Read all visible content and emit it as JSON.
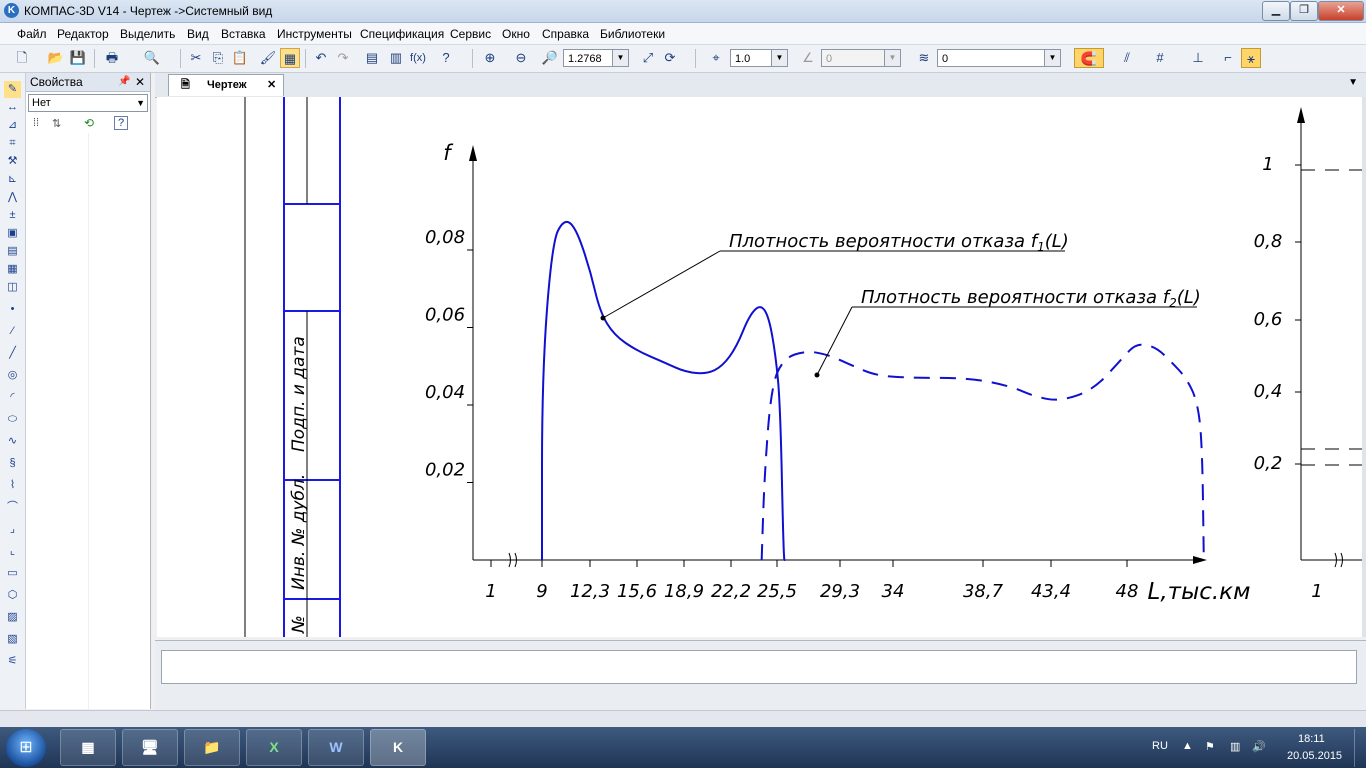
{
  "window": {
    "title": "КОМПАС-3D V14 - Чертеж ->Системный вид",
    "app_icon_letter": "K"
  },
  "menu": [
    "Файл",
    "Редактор",
    "Выделить",
    "Вид",
    "Вставка",
    "Инструменты",
    "Спецификация",
    "Сервис",
    "Окно",
    "Справка",
    "Библиотеки"
  ],
  "toolbar": {
    "zoom_value": "1.2768",
    "step_value": "1.0",
    "angle_value": "0",
    "layer_value": "0"
  },
  "properties": {
    "title": "Свойства",
    "select_value": "Нет"
  },
  "document_tab": {
    "label": "Чертеж"
  },
  "stamp": {
    "label_sign_date": "Подп. и дата",
    "label_inv_dubl": "Инв. № дубл.",
    "label_inv": "№"
  },
  "chart_data": {
    "type": "line",
    "ylabel": "f",
    "xlabel": "L,тыс.км",
    "x_tick_labels": [
      "1",
      "9",
      "12,3",
      "15,6",
      "18,9",
      "22,2",
      "25,5",
      "29,3",
      "34",
      "38,7",
      "43,4",
      "48"
    ],
    "y_tick_labels": [
      "0,02",
      "0,04",
      "0,06",
      "0,08"
    ],
    "right_axis_tick_labels": [
      "0,2",
      "0,4",
      "0,6",
      "0,8",
      "1"
    ],
    "right_axis_bottom_label": "1",
    "series": [
      {
        "name": "Плотность вероятности отказа f1(L)",
        "style": "solid",
        "points": [
          [
            9,
            0
          ],
          [
            9,
            0.048
          ],
          [
            9.7,
            0.082
          ],
          [
            10.5,
            0.088
          ],
          [
            11.3,
            0.086
          ],
          [
            12.3,
            0.075
          ],
          [
            13,
            0.064
          ],
          [
            14,
            0.058
          ],
          [
            15.6,
            0.054
          ],
          [
            17.5,
            0.051
          ],
          [
            19,
            0.0485
          ],
          [
            20.5,
            0.048
          ],
          [
            21.6,
            0.05
          ],
          [
            22.6,
            0.055
          ],
          [
            23.5,
            0.063
          ],
          [
            24.3,
            0.066
          ],
          [
            24.9,
            0.063
          ],
          [
            25.4,
            0.053
          ],
          [
            25.7,
            0.04
          ],
          [
            25.9,
            0
          ],
          [
            26,
            0
          ]
        ]
      },
      {
        "name": "Плотность вероятности отказа f2(L)",
        "style": "dashed",
        "points": [
          [
            24.4,
            0
          ],
          [
            24.6,
            0.022
          ],
          [
            25.1,
            0.045
          ],
          [
            25.9,
            0.052
          ],
          [
            27.2,
            0.054
          ],
          [
            28.6,
            0.053
          ],
          [
            30.5,
            0.05
          ],
          [
            32.6,
            0.0475
          ],
          [
            35.1,
            0.047
          ],
          [
            37.9,
            0.047
          ],
          [
            40.5,
            0.045
          ],
          [
            42.4,
            0.042
          ],
          [
            44,
            0.041
          ],
          [
            46,
            0.044
          ],
          [
            47.7,
            0.052
          ],
          [
            48.6,
            0.056
          ],
          [
            49.8,
            0.055
          ],
          [
            50.8,
            0.051
          ],
          [
            51.7,
            0.047
          ],
          [
            52.4,
            0.041
          ],
          [
            52.7,
            0.03
          ],
          [
            52.8,
            0
          ]
        ]
      }
    ],
    "labels": {
      "f1": "Плотность вероятности отказа f",
      "f1_sub": "1",
      "f2_sub": "2",
      "f_suffix": "(L)"
    }
  },
  "taskbar": {
    "lang": "RU",
    "time": "18:11",
    "date": "20.05.2015"
  },
  "colors": {
    "line": "#1010d0",
    "frame": "#1a1ae0",
    "black": "#000000"
  }
}
